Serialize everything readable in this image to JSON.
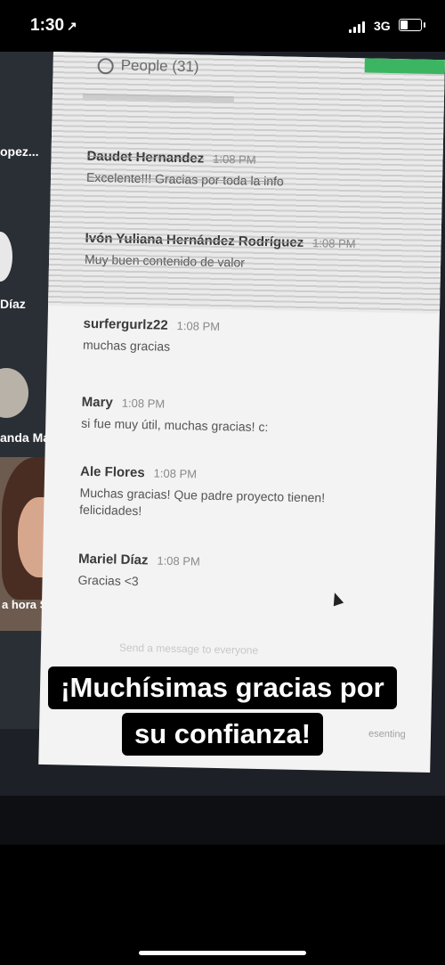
{
  "status_bar": {
    "time": "1:30",
    "network": "3G",
    "location_glyph": "↗"
  },
  "participants": [
    {
      "name": "opez..."
    },
    {
      "name": "Díaz"
    },
    {
      "name": "anda Ma..."
    },
    {
      "name": "a hora Sat ..."
    }
  ],
  "chat_panel": {
    "header": "People (31)",
    "messages": [
      {
        "sender": "Daudet Hernandez",
        "time": "1:08 PM",
        "text": "Excelente!!! Gracias por toda la info"
      },
      {
        "sender": "Ivón Yuliana Hernández Rodríguez",
        "time": "1:08 PM",
        "text": "Muy buen contenido de valor"
      },
      {
        "sender": "surfergurlz22",
        "time": "1:08 PM",
        "text": "muchas gracias"
      },
      {
        "sender": "Mary",
        "time": "1:08 PM",
        "text": "si fue muy útil, muchas gracias! c:"
      },
      {
        "sender": "Ale Flores",
        "time": "1:08 PM",
        "text": "Muchas gracias! Que padre proyecto tienen! felicidades!"
      },
      {
        "sender": "Mariel Díaz",
        "time": "1:08 PM",
        "text": "Gracias <3"
      }
    ],
    "input_placeholder": "Send a message to everyone",
    "presenting": "esenting"
  },
  "caption": {
    "line1": "¡Muchísimas gracias por",
    "line2": "su confianza!"
  },
  "colors": {
    "accent_green": "#3cb563",
    "chat_bg": "#f3f3f3"
  }
}
